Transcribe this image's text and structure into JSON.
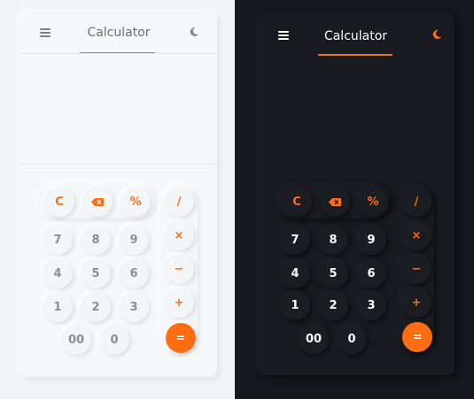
{
  "colors": {
    "accent": "#ff6d12",
    "light_bg": "#f3f4f6",
    "dark_bg": "#16181d"
  },
  "light": {
    "header": {
      "title": "Calculator",
      "menu_icon": "menu-icon",
      "theme_icon": "moon-icon"
    },
    "keys": {
      "clear": "C",
      "backspace_icon": "backspace-icon",
      "percent": "%",
      "divide": "/",
      "multiply": "×",
      "minus": "−",
      "plus": "+",
      "equals": "=",
      "seven": "7",
      "eight": "8",
      "nine": "9",
      "four": "4",
      "five": "5",
      "six": "6",
      "one": "1",
      "two": "2",
      "three": "3",
      "double_zero": "00",
      "zero": "0"
    }
  },
  "dark": {
    "header": {
      "title": "Calculator",
      "menu_icon": "menu-icon",
      "theme_icon": "moon-icon"
    },
    "keys": {
      "clear": "C",
      "backspace_icon": "backspace-icon",
      "percent": "%",
      "divide": "/",
      "multiply": "×",
      "minus": "−",
      "plus": "+",
      "equals": "=",
      "seven": "7",
      "eight": "8",
      "nine": "9",
      "four": "4",
      "five": "5",
      "six": "6",
      "one": "1",
      "two": "2",
      "three": "3",
      "double_zero": "00",
      "zero": "0"
    }
  }
}
